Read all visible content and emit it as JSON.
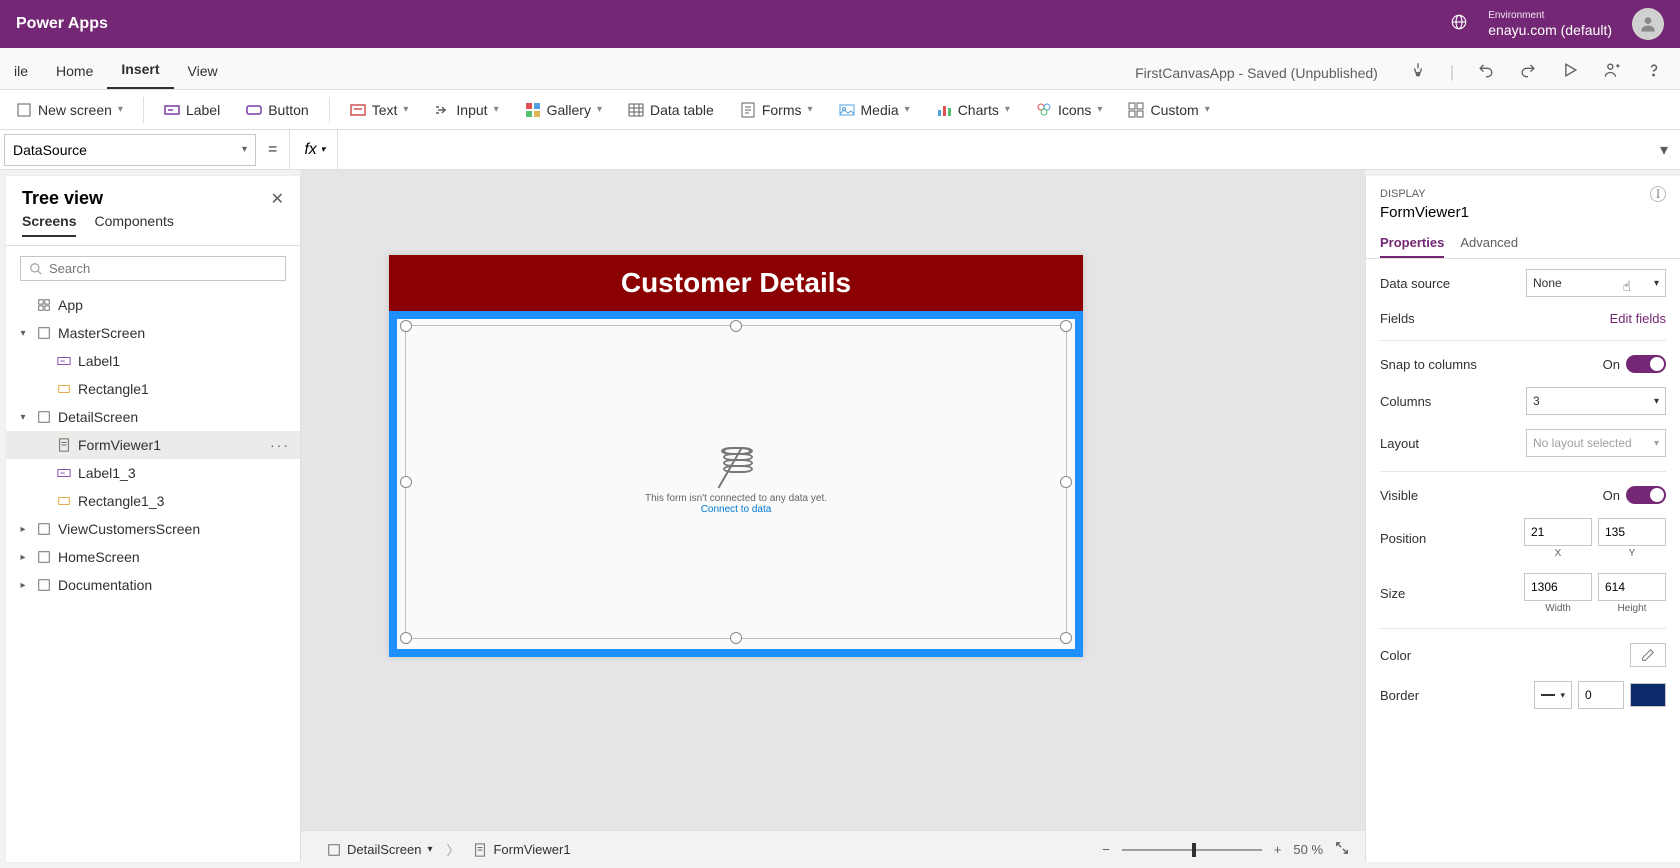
{
  "header": {
    "appTitle": "Power Apps",
    "envLabel": "Environment",
    "envValue": "enayu.com (default)"
  },
  "menu": {
    "items": [
      "ile",
      "Home",
      "Insert",
      "View"
    ],
    "activeIndex": 2,
    "appStatus": "FirstCanvasApp - Saved (Unpublished)"
  },
  "ribbon": {
    "newScreen": "New screen",
    "label": "Label",
    "button": "Button",
    "text": "Text",
    "input": "Input",
    "gallery": "Gallery",
    "dataTable": "Data table",
    "forms": "Forms",
    "media": "Media",
    "charts": "Charts",
    "icons": "Icons",
    "custom": "Custom"
  },
  "formula": {
    "property": "DataSource",
    "fx": "fx",
    "value": ""
  },
  "tree": {
    "title": "Tree view",
    "tabs": {
      "screens": "Screens",
      "components": "Components"
    },
    "searchPlaceholder": "Search",
    "app": "App",
    "items": [
      {
        "label": "MasterScreen",
        "icon": "screen"
      },
      {
        "label": "Label1",
        "icon": "label",
        "indent": 2
      },
      {
        "label": "Rectangle1",
        "icon": "shape",
        "indent": 2
      },
      {
        "label": "DetailScreen",
        "icon": "screen"
      },
      {
        "label": "FormViewer1",
        "icon": "form",
        "indent": 2,
        "selected": true
      },
      {
        "label": "Label1_3",
        "icon": "label",
        "indent": 2
      },
      {
        "label": "Rectangle1_3",
        "icon": "shape",
        "indent": 2
      },
      {
        "label": "ViewCustomersScreen",
        "icon": "screen",
        "collapsed": true
      },
      {
        "label": "HomeScreen",
        "icon": "screen",
        "collapsed": true
      },
      {
        "label": "Documentation",
        "icon": "screen",
        "collapsed": true
      }
    ]
  },
  "canvas": {
    "titleBar": "Customer Details",
    "emptyMsg": "This form isn't connected to any data yet.",
    "connectLink": "Connect to data"
  },
  "breadcrumb": {
    "screen": "DetailScreen",
    "element": "FormViewer1",
    "zoom": "50",
    "zoomUnit": "%"
  },
  "props": {
    "eyebrow": "DISPLAY",
    "title": "FormViewer1",
    "tabs": {
      "properties": "Properties",
      "advanced": "Advanced"
    },
    "dataSource": {
      "label": "Data source",
      "value": "None"
    },
    "fields": {
      "label": "Fields",
      "link": "Edit fields"
    },
    "snap": {
      "label": "Snap to columns",
      "state": "On"
    },
    "columns": {
      "label": "Columns",
      "value": "3"
    },
    "layout": {
      "label": "Layout",
      "value": "No layout selected"
    },
    "visible": {
      "label": "Visible",
      "state": "On"
    },
    "position": {
      "label": "Position",
      "x": "21",
      "y": "135",
      "xLabel": "X",
      "yLabel": "Y"
    },
    "size": {
      "label": "Size",
      "w": "1306",
      "h": "614",
      "wLabel": "Width",
      "hLabel": "Height"
    },
    "color": {
      "label": "Color"
    },
    "border": {
      "label": "Border",
      "width": "0"
    }
  }
}
